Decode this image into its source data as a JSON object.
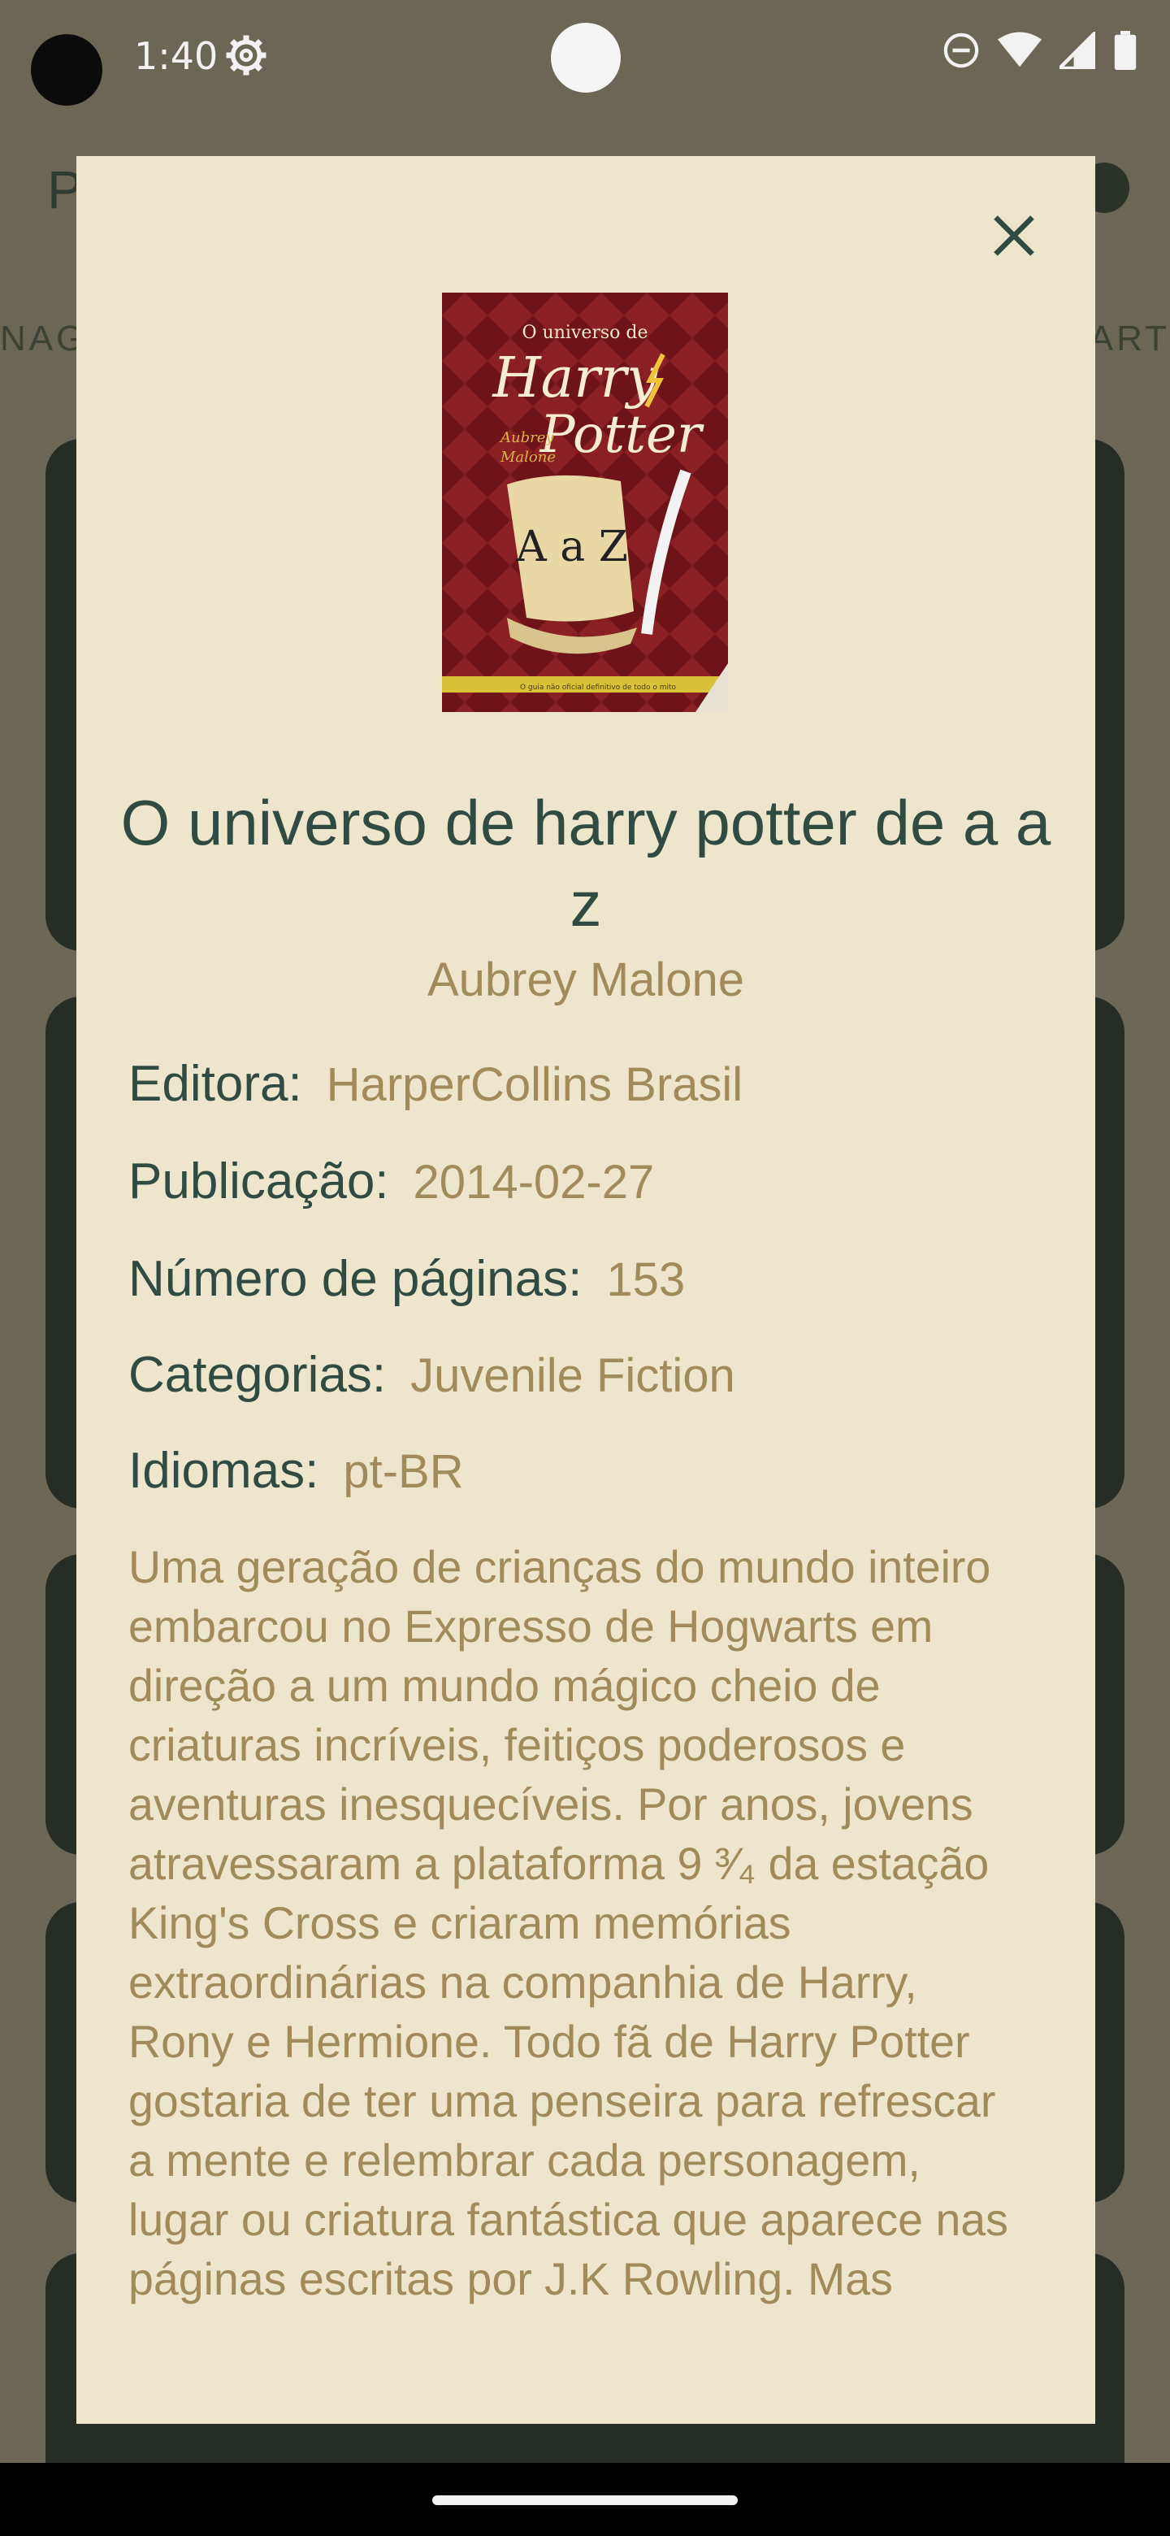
{
  "status_bar": {
    "time": "1:40",
    "icons": [
      "settings-gear-icon",
      "do-not-disturb-icon",
      "wifi-icon",
      "signal-icon",
      "battery-icon"
    ]
  },
  "background_app": {
    "title_partial": "P",
    "tab_left_partial": "NAG",
    "tab_right_partial": "ART",
    "info_icon": "info-icon"
  },
  "dialog": {
    "close_icon": "close-icon",
    "cover": {
      "line1": "O universo de",
      "line2": "Harry",
      "line3": "Potter",
      "author_line1": "Aubrey",
      "author_line2": "Malone",
      "az": "A a Z",
      "tagline": "O guia não oficial definitivo de todo o mito"
    },
    "book_title": "O universo de harry potter de a a z",
    "author": "Aubrey Malone",
    "fields": [
      {
        "label": "Editora:",
        "value": "HarperCollins Brasil"
      },
      {
        "label": "Publicação:",
        "value": "2014-02-27"
      },
      {
        "label": "Número de páginas:",
        "value": "153"
      },
      {
        "label": "Categorias:",
        "value": "Juvenile Fiction"
      },
      {
        "label": "Idiomas:",
        "value": "pt-BR"
      }
    ],
    "description": "Uma geração de crianças do mundo inteiro embarcou no Expresso de Hogwarts em direção a um mundo mágico cheio de criaturas incríveis, feitiços poderosos e aventuras inesquecíveis. Por anos, jovens atravessaram a plataforma 9 ³⁄₄ da estação King's Cross e criaram memórias extraordinárias na companhia de Harry, Rony e Hermione. Todo fã de Harry Potter gostaria de ter uma penseira para refrescar a mente e relembrar cada personagem, lugar ou criatura fantástica que aparece nas páginas escritas por J.K Rowling. Mas"
  },
  "colors": {
    "scrim": "#6b6656",
    "dialog_bg": "#ede6cc",
    "label": "#324b42",
    "value": "#a18a5b"
  }
}
